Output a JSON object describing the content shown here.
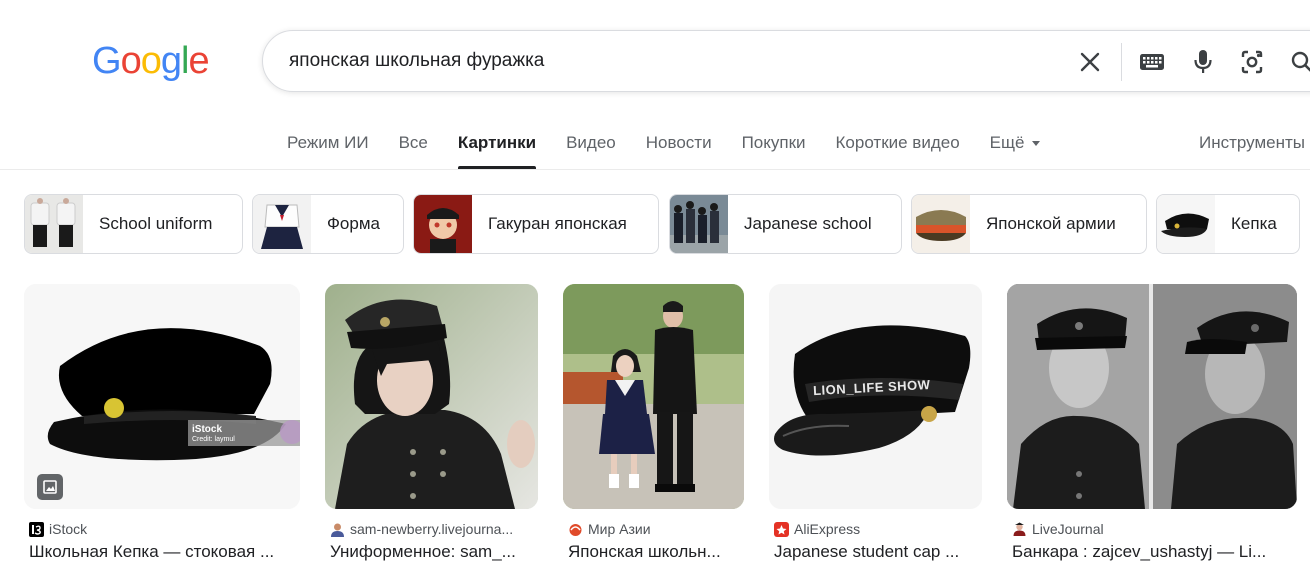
{
  "logo": {
    "text": "Google",
    "letters": [
      "G",
      "o",
      "o",
      "g",
      "l",
      "e"
    ],
    "colors": [
      "#4285F4",
      "#EA4335",
      "#FBBC05",
      "#4285F4",
      "#34A853",
      "#EA4335"
    ]
  },
  "search": {
    "query": "японская школьная фуражка"
  },
  "tabs": [
    {
      "label": "Режим ИИ",
      "active": false
    },
    {
      "label": "Все",
      "active": false
    },
    {
      "label": "Картинки",
      "active": true
    },
    {
      "label": "Видео",
      "active": false
    },
    {
      "label": "Новости",
      "active": false
    },
    {
      "label": "Покупки",
      "active": false
    },
    {
      "label": "Короткие видео",
      "active": false
    },
    {
      "label": "Ещё",
      "active": false,
      "dropdown": true
    }
  ],
  "tools_label": "Инструменты",
  "chips": [
    {
      "label": "School uniform",
      "thumb": "uniform-rack"
    },
    {
      "label": "Форма",
      "thumb": "sailor-uniform"
    },
    {
      "label": "Гакуран японская",
      "thumb": "anime-character"
    },
    {
      "label": "Japanese school",
      "thumb": "students-group"
    },
    {
      "label": "Японской армии",
      "thumb": "army-cap"
    },
    {
      "label": "Кепка",
      "thumb": "black-cap"
    }
  ],
  "results": [
    {
      "source": "iStock",
      "title": "Школьная Кепка — стоковая ...",
      "favicon_color": "#000000"
    },
    {
      "source": "sam-newberry.livejourna...",
      "title": "Униформенное: sam_...",
      "favicon_color": "#4a5a9a"
    },
    {
      "source": "Мир Азии",
      "title": "Японская школьн...",
      "favicon_color": "#e04a2a"
    },
    {
      "source": "AliExpress",
      "title": "Japanese student cap ...",
      "favicon_color": "#e43225"
    },
    {
      "source": "LiveJournal",
      "title": "Банкара : zajcev_ushastyj — Li...",
      "favicon_color": "#8a1c1c"
    }
  ],
  "image_text": {
    "istock_watermark": "iStock",
    "istock_credit": "Credit: laymul",
    "ali_watermark": "LION_LIFE SHOW"
  }
}
